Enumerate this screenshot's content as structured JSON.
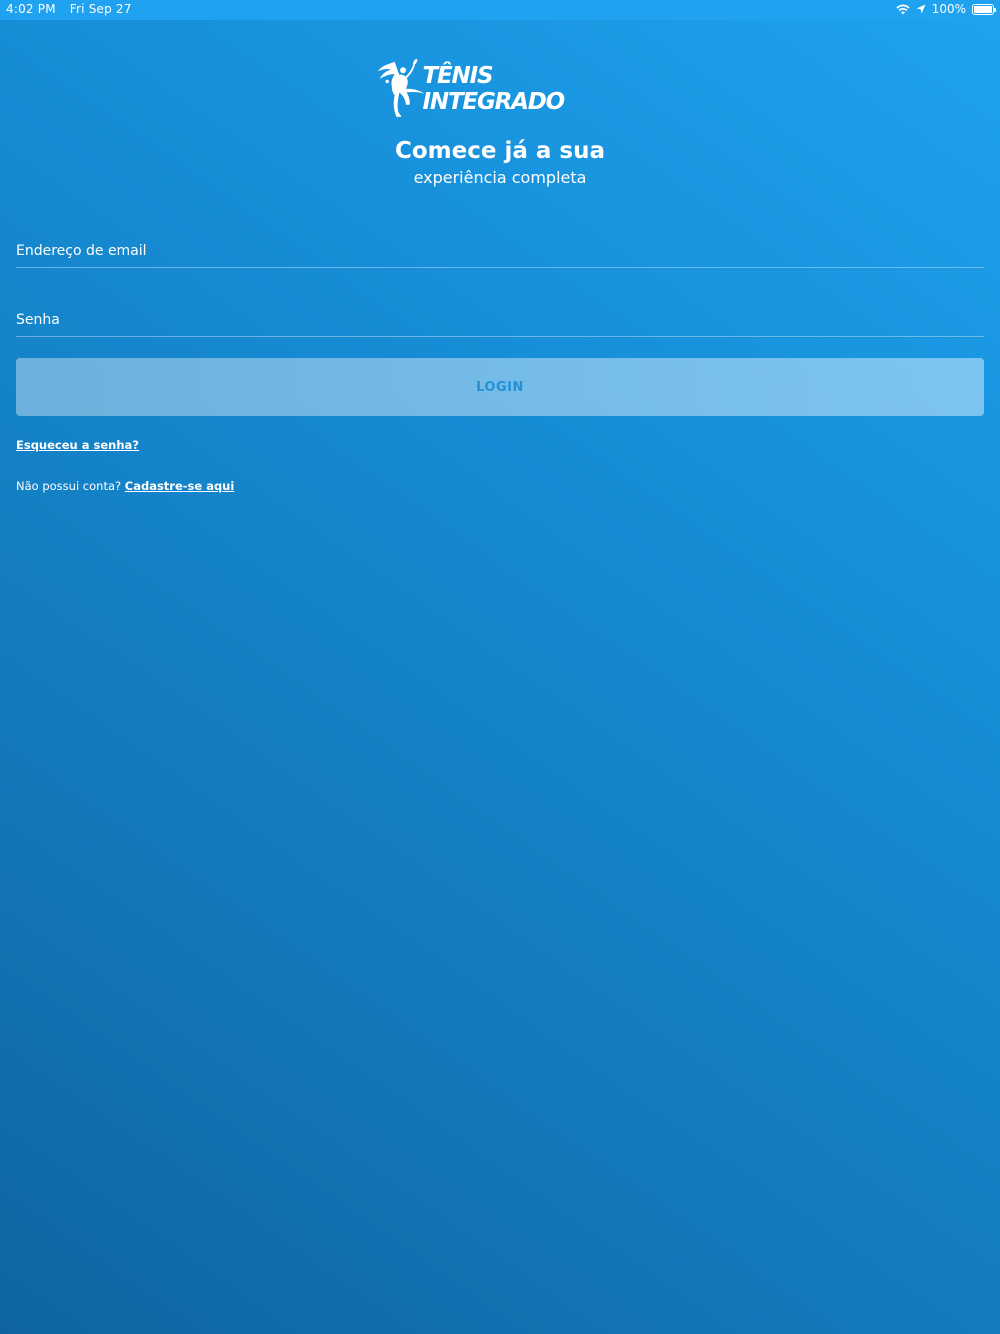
{
  "status_bar": {
    "time": "4:02 PM",
    "date": "Fri Sep 27",
    "battery": "100%",
    "battery_level": 1.0,
    "icons": [
      "wifi-icon",
      "location-arrow-icon",
      "battery-icon"
    ]
  },
  "brand": {
    "logo_text": "TÊNIS INTEGRADO"
  },
  "hero": {
    "title": "Comece já a sua",
    "subtitle": "experiência completa"
  },
  "form": {
    "email_placeholder": "Endereço de email",
    "email_value": "",
    "password_placeholder": "Senha",
    "password_value": "",
    "login_label": "LOGIN",
    "forgot_label": "Esqueceu a senha?",
    "signup_prompt": "Não possui conta?",
    "signup_link": "Cadastre-se aqui"
  },
  "colors": {
    "background_top": "#1ea3ef",
    "background_bottom": "#0f64a0",
    "login_text": "#2391d4"
  }
}
